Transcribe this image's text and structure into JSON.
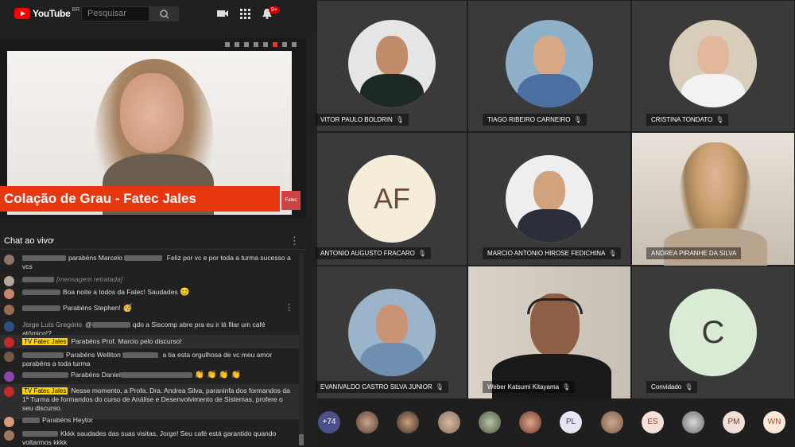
{
  "youtube": {
    "brand": "YouTube",
    "country": "BR",
    "search_placeholder": "Pesquisar",
    "notification_count": "9+",
    "icons": [
      "youtube-logo-icon",
      "search-icon",
      "camera-icon",
      "apps-grid-icon",
      "bell-icon"
    ]
  },
  "video": {
    "lower_third": "Colação de Grau - Fatec Jales",
    "logo_text": "Fatec"
  },
  "chat": {
    "title": "Chat ao vivo",
    "messages": [
      {
        "name": "",
        "text": "parabéns Marcelo ",
        "text2": " Feliz por vc e por toda a turma sucesso a vcs"
      },
      {
        "name": "",
        "text": "[mensagem retratada]"
      },
      {
        "name": "",
        "text": "Boa noite a todos da Fatec! Saudades",
        "emoji": "😊"
      },
      {
        "name": "",
        "text": "Parabéns Stephen!",
        "emoji": "🥳"
      },
      {
        "name": "Jorge Luís Gregório",
        "text": "@",
        "text2": "qdo a Siscomp abre pra eu ir lá filar um café atômico!?"
      },
      {
        "name": "TV Fatec Jales",
        "text": "Parabéns Prof. Marcio pelo discurso!"
      },
      {
        "name": "",
        "text": "Parabéns Welliton ",
        "text2": " a tia esta orgulhosa de vc meu amor parabéns a toda turma"
      },
      {
        "name": "",
        "text": "Parabéns Daniel",
        "emoji": "👏 👏 👏 👏"
      },
      {
        "name": "TV Fatec Jales",
        "text": "Nesse momento, a Profa. Dra. Andrea Silva, paraninfa dos formandos da 1ª Turma de formandos do curso de Análise e Desenvolvimento de Sistemas, profere o seu discurso."
      },
      {
        "name": "",
        "text": "Parabéns Heytor"
      },
      {
        "name": "",
        "text": "Kkkk saudades das suas visitas, Jorge! Seu café está garantido quando voltarmos kkkk"
      }
    ]
  },
  "participants": [
    {
      "name": "VITOR PAULO BOLDRIN",
      "kind": "photo",
      "color": "#6e7b86"
    },
    {
      "name": "TIAGO RIBEIRO CARNEIRO",
      "kind": "photo",
      "color": "#8fb0c9"
    },
    {
      "name": "CRISTINA TONDATO",
      "kind": "photo",
      "color": "#c8b49a"
    },
    {
      "name": "ANTONIO AUGUSTO FRACARO",
      "kind": "initials",
      "initials": "AF"
    },
    {
      "name": "MARCIO ANTONIO HIROSE FEDICHINA",
      "kind": "photo",
      "color": "#e8e8e8"
    },
    {
      "name": "ANDREA PIRANHE DA SILVA",
      "kind": "video"
    },
    {
      "name": "EVANIVALDO CASTRO SILVA JUNIOR",
      "kind": "photo",
      "color": "#9bb4c9"
    },
    {
      "name": "Weber Katsumi Kitayama",
      "kind": "video"
    },
    {
      "name": "Convidado",
      "kind": "initials",
      "initials": "C"
    }
  ],
  "bottom_strip": [
    "+74",
    "",
    "",
    "",
    "",
    "",
    "PL",
    "",
    "ES",
    "",
    "PM",
    "WN"
  ]
}
